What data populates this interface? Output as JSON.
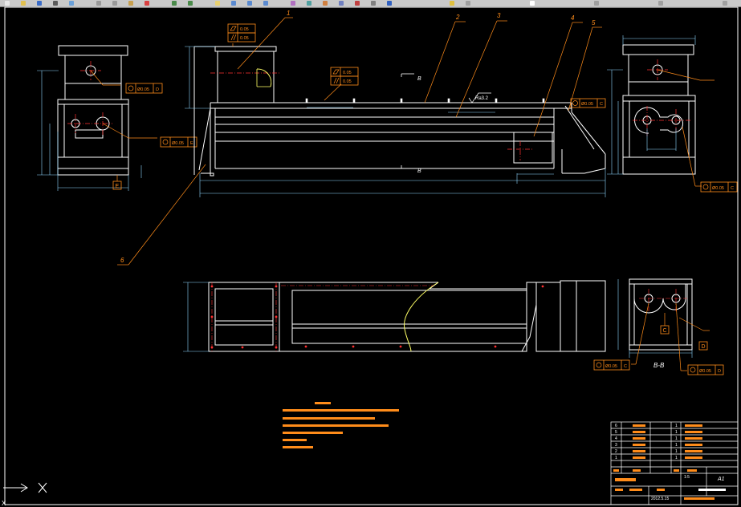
{
  "window": {
    "cad_view": "model space",
    "background_color": "#000000",
    "line_colors": {
      "outline": "#ffffff",
      "callout": "#ff8c1a",
      "centerline": "#ff3030",
      "dimension": "#8fd8ff",
      "highlight": "#ffff66"
    }
  },
  "balloons": [
    "1",
    "2",
    "3",
    "4",
    "5",
    "6"
  ],
  "section_marks": {
    "top": "B",
    "bottom": "B",
    "section_view_label": "B-B"
  },
  "datum_labels": {
    "left_view": "E",
    "section_view_1": "C",
    "section_view_2": "D"
  },
  "tolerance_frames": {
    "top_flatness": "0.05",
    "top_parallel": "0.05",
    "mid_flatness": "0.05",
    "mid_parallel": "0.05",
    "left_position": "Ø0.05",
    "left_position_datum": "D",
    "left_mid_position": "Ø0.05",
    "left_mid_datum": "E",
    "right_pos_1": "Ø0.05",
    "right_pos_1_datum": "C",
    "right_pos_2": "Ø0.05",
    "right_pos_2_datum": "C",
    "bottom_pos_1": "Ø0.05",
    "bottom_pos_1_datum": "C",
    "bottom_pos_2": "Ø0.05",
    "bottom_pos_2_datum": "D"
  },
  "surface_finish": "Ra3.2",
  "title_block": {
    "sheet_size": "A1",
    "scale": "1:5",
    "date": "2012.5.15",
    "rows": [
      {
        "no": "6",
        "qty": "1"
      },
      {
        "no": "5",
        "qty": "1"
      },
      {
        "no": "4",
        "qty": "1"
      },
      {
        "no": "3",
        "qty": "1"
      },
      {
        "no": "2",
        "qty": "1"
      },
      {
        "no": "1",
        "qty": "1"
      }
    ]
  },
  "cmdline": {
    "cursor_glyph": "X"
  }
}
